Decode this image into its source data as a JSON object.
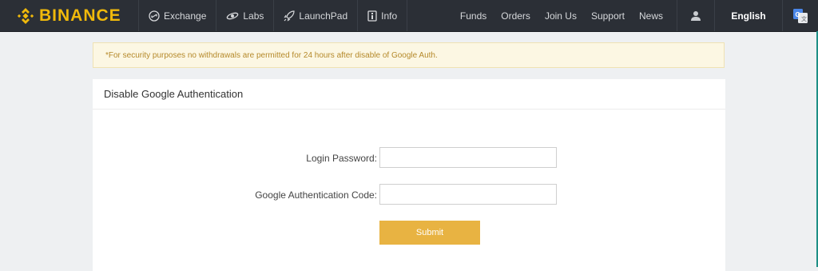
{
  "brand": {
    "name": "BINANCE",
    "accent": "#f0b90b"
  },
  "nav": {
    "left": [
      {
        "label": "Exchange",
        "icon": "exchange-icon"
      },
      {
        "label": "Labs",
        "icon": "labs-icon"
      },
      {
        "label": "LaunchPad",
        "icon": "rocket-icon"
      },
      {
        "label": "Info",
        "icon": "info-icon"
      }
    ],
    "right": [
      "Funds",
      "Orders",
      "Join Us",
      "Support",
      "News"
    ],
    "user_icon": "user-icon",
    "language": "English",
    "translate_icon": "google-translate-icon"
  },
  "notice": {
    "text": "*For security purposes no withdrawals are permitted for 24 hours after disable of Google Auth.",
    "color": "#b5892a"
  },
  "panel": {
    "title": "Disable Google Authentication",
    "fields": [
      {
        "label": "Login Password:",
        "value": ""
      },
      {
        "label": "Google Authentication Code:",
        "value": ""
      }
    ],
    "submit_label": "Submit",
    "submit_color": "#e8b342"
  }
}
